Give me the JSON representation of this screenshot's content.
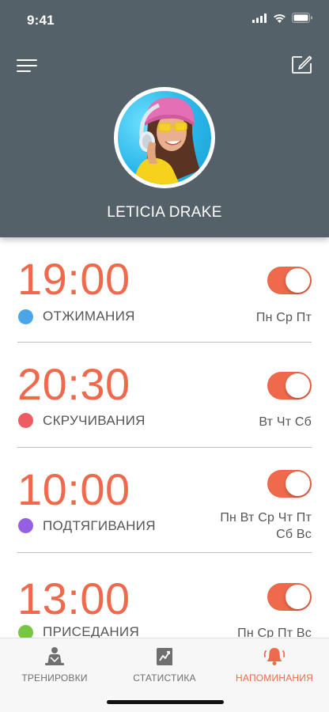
{
  "status_bar": {
    "time": "9:41"
  },
  "header": {
    "menu_icon": "hamburger-menu-icon",
    "edit_icon": "edit-square-icon",
    "user_name": "LETICIA DRAKE"
  },
  "reminders": [
    {
      "time": "19:00",
      "exercise": "ОТЖИМАНИЯ",
      "days": "Пн Ср Пт",
      "color": "#4aa6e8",
      "enabled": true
    },
    {
      "time": "20:30",
      "exercise": "СКРУЧИВАНИЯ",
      "days": "Вт Чт Сб",
      "color": "#ee5b63",
      "enabled": true
    },
    {
      "time": "10:00",
      "exercise": "ПОДТЯГИВАНИЯ",
      "days_line1": "Пн Вт Ср Чт Пт",
      "days_line2": "Сб Вс",
      "color": "#9460e3",
      "enabled": true
    },
    {
      "time": "13:00",
      "exercise": "ПРИСЕДАНИЯ",
      "days": "Пн Ср Пт Вс",
      "color": "#78c443",
      "enabled": true
    }
  ],
  "tabs": [
    {
      "label": "ТРЕНИРОВКИ",
      "icon": "workout-person-icon",
      "active": false
    },
    {
      "label": "СТАТИСТИКА",
      "icon": "statistics-chart-icon",
      "active": false
    },
    {
      "label": "НАПОМИНАНИЯ",
      "icon": "bell-icon",
      "active": true
    }
  ],
  "colors": {
    "header_bg": "#546169",
    "accent": "#ef6a4c"
  }
}
